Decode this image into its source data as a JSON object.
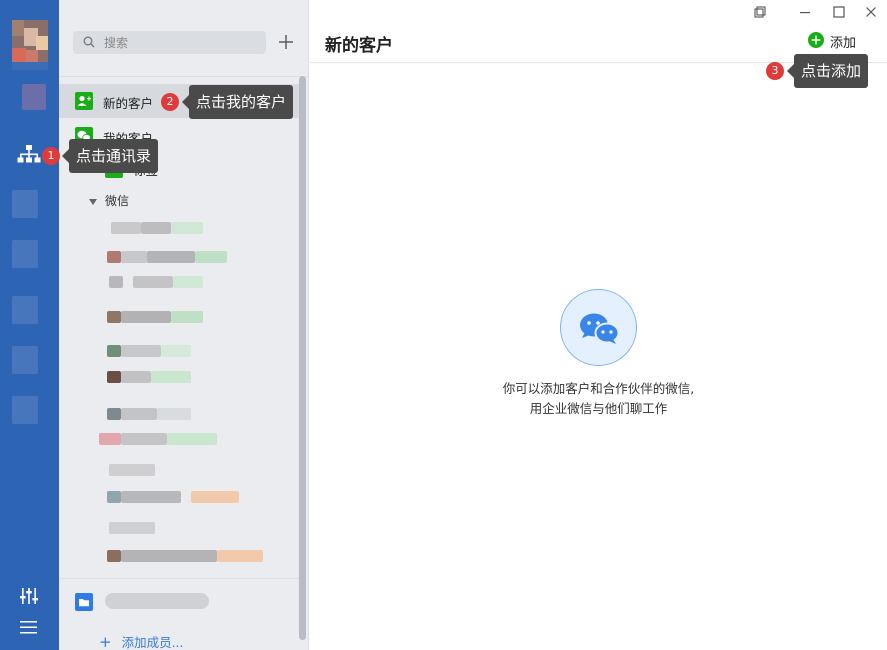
{
  "rail": {
    "icons": [
      "avatar",
      "contacts-icon",
      "settings-sliders-icon",
      "menu-icon"
    ]
  },
  "search": {
    "placeholder": "搜索"
  },
  "nav": {
    "new_customers": "新的客户",
    "my_customers": "我的客户",
    "tag_label": "标签",
    "wechat_group": "微信",
    "add_member": "添加成员..."
  },
  "main": {
    "title": "新的客户",
    "add_label": "添加",
    "empty_line1": "你可以添加客户和合作伙伴的微信,",
    "empty_line2": "用企业微信与他们聊工作"
  },
  "callouts": {
    "c1_num": "1",
    "c1_text": "点击通讯录",
    "c2_num": "2",
    "c2_text": "点击我的客户",
    "c3_num": "3",
    "c3_text": "点击添加"
  },
  "colors": {
    "rail": "#2e64b4",
    "accent_green": "#1aad19",
    "badge_red": "#e03b3b",
    "link_blue": "#3a79d8"
  }
}
